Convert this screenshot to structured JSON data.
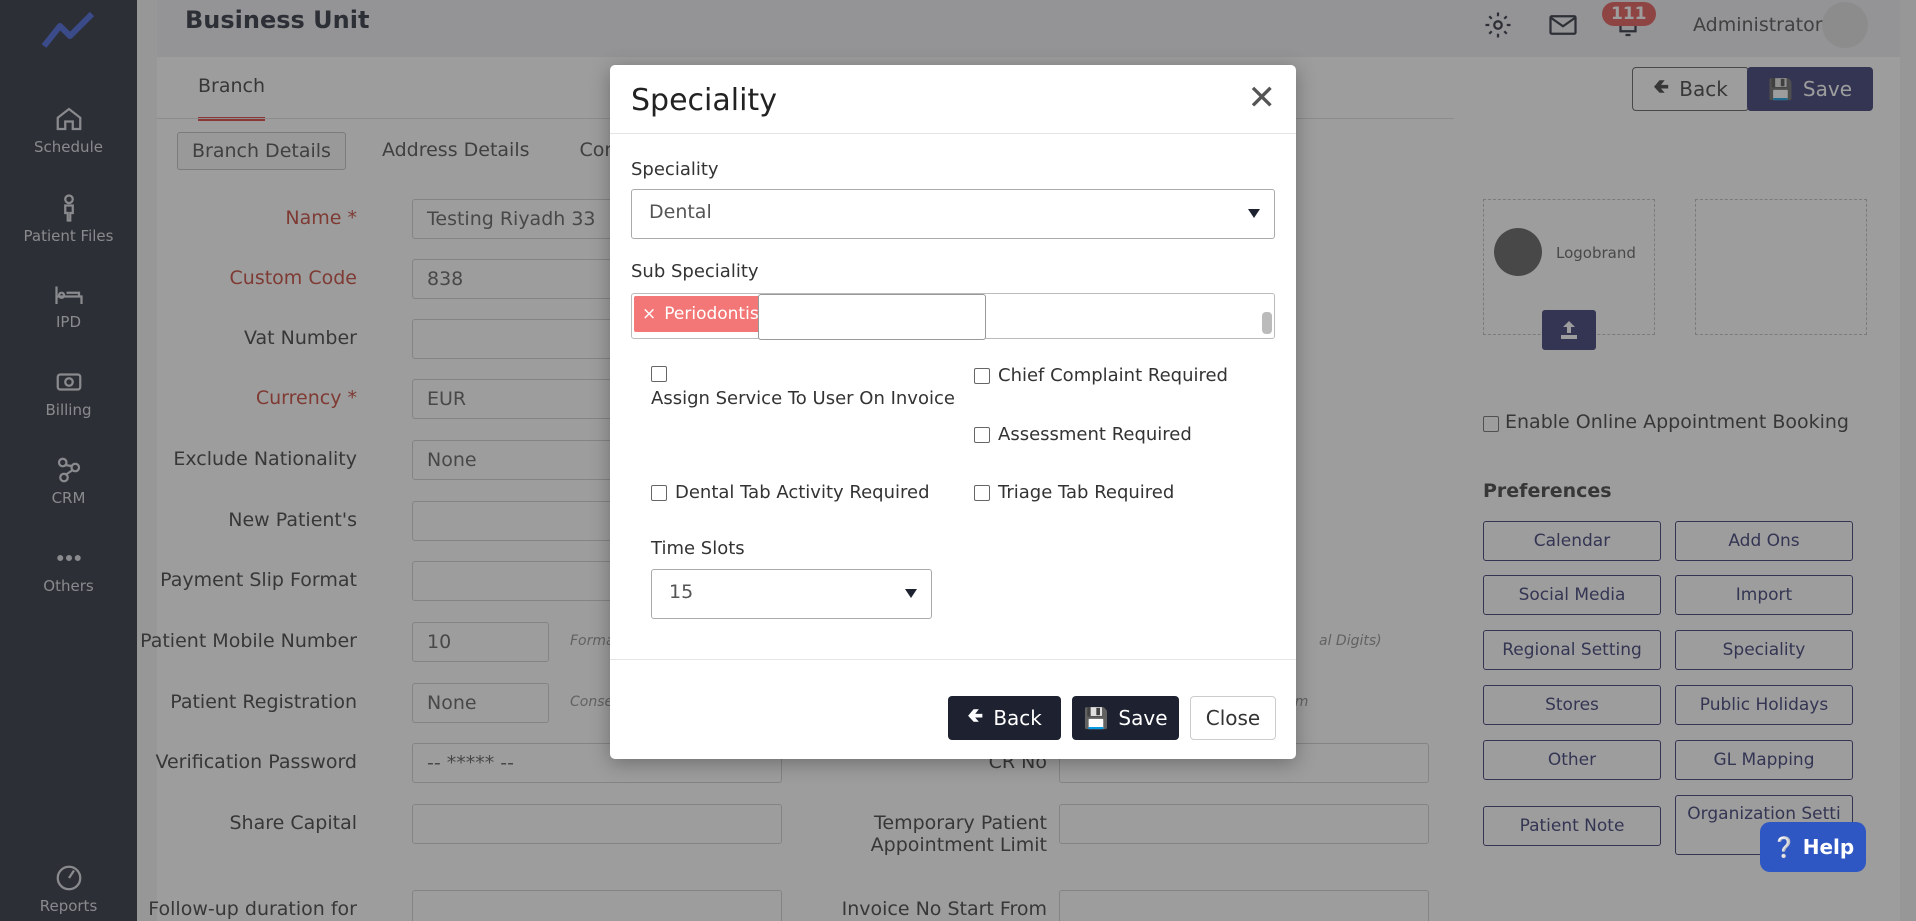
{
  "app": {
    "page_title": "Business Unit",
    "notifications_count": "111",
    "user_name": "Administrator"
  },
  "sidebar": {
    "items": [
      {
        "label": "Schedule",
        "icon": "home-icon"
      },
      {
        "label": "Patient Files",
        "icon": "person-icon"
      },
      {
        "label": "IPD",
        "icon": "bed-icon"
      },
      {
        "label": "Billing",
        "icon": "money-icon"
      },
      {
        "label": "CRM",
        "icon": "network-icon"
      },
      {
        "label": "Others",
        "icon": "dots-icon"
      },
      {
        "label": "Reports",
        "icon": "chart-icon"
      }
    ]
  },
  "main": {
    "tab": "Branch",
    "back_label": "Back",
    "save_label": "Save",
    "subtabs": [
      "Branch Details",
      "Address Details",
      "Contact D"
    ],
    "fields": {
      "name_label": "Name *",
      "name_value": "Testing Riyadh 33",
      "custom_code_label": "Custom Code",
      "custom_code_value": "838",
      "vat_label": "Vat Number",
      "currency_label": "Currency *",
      "currency_value": "EUR",
      "exclude_nationality_label": "Exclude Nationality",
      "exclude_nationality_value": "None",
      "new_patients_label": "New Patient's",
      "payment_slip_label": "Payment Slip Format",
      "mobile_label": "Patient Mobile Number",
      "mobile_value": "10",
      "mobile_hint": "Forma",
      "mobile_hint_right": "al Digits)",
      "registration_label": "Patient Registration",
      "registration_value": "None",
      "registration_hint": "Conse",
      "registration_hint_right": "rm",
      "verification_label": "Verification Password",
      "verification_value": "-- ***** --",
      "cr_label": "CR No",
      "share_capital_label": "Share Capital",
      "temp_patient_label_1": "Temporary Patient",
      "temp_patient_label_2": "Appointment Limit",
      "followup_label": "Follow-up duration for",
      "invoice_start_label": "Invoice No Start From"
    },
    "logo_text": "Logobrand",
    "online_booking": "Enable Online Appointment Booking",
    "preferences_title": "Preferences",
    "preferences": [
      "Calendar",
      "Add Ons",
      "Social Media",
      "Import",
      "Regional Setting",
      "Speciality",
      "Stores",
      "Public Holidays",
      "Other",
      "GL Mapping",
      "Patient Note",
      "Organization Setti"
    ],
    "help_label": "Help"
  },
  "modal": {
    "title": "Speciality",
    "speciality_label": "Speciality",
    "speciality_value": "Dental",
    "sub_speciality_label": "Sub Speciality",
    "sub_speciality_chip": "Periodontist",
    "checkboxes": {
      "assign_service": "Assign Service To User On Invoice",
      "chief_complaint": "Chief Complaint Required",
      "assessment": "Assessment Required",
      "dental_tab": "Dental Tab Activity Required",
      "triage_tab": "Triage Tab Required"
    },
    "time_slots_label": "Time Slots",
    "time_slots_value": "15",
    "back_label": "Back",
    "save_label": "Save",
    "close_label": "Close"
  }
}
